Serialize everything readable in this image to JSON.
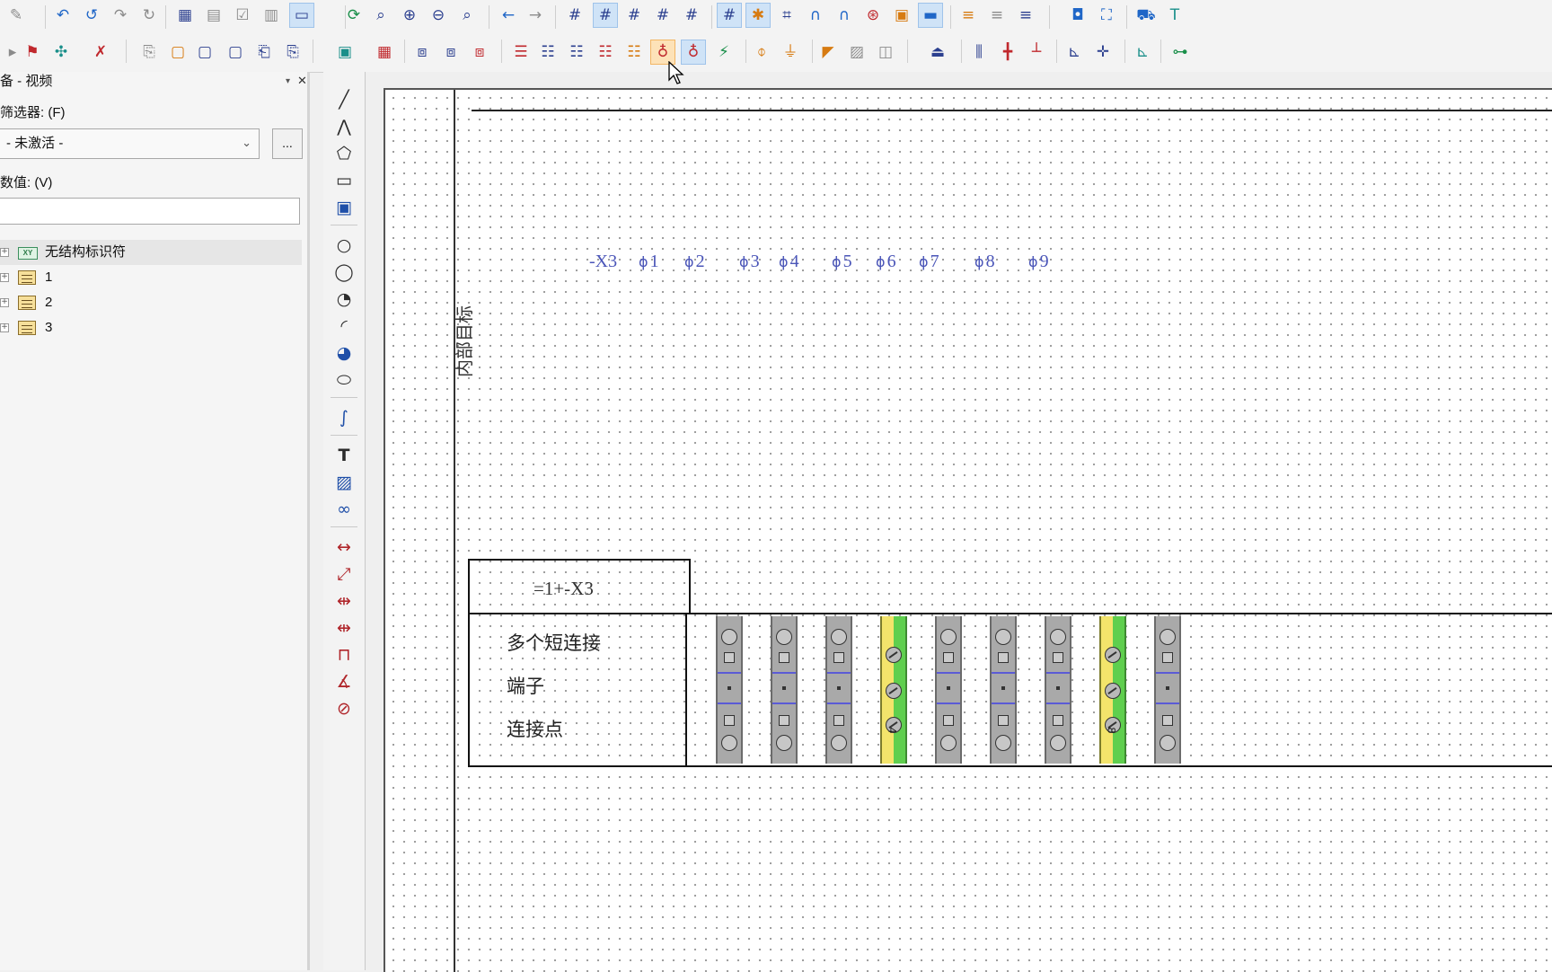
{
  "left_panel": {
    "title": "备 - 视频",
    "filter_label": "筛选器: (F)",
    "filter_value": "- 未激活 -",
    "more_button": "...",
    "value_label": "数值: (V)",
    "value_input": "",
    "tree": [
      {
        "label": "无结构标识符",
        "icon": "xy-structure-icon",
        "selected": true
      },
      {
        "label": "1",
        "icon": "list-icon",
        "selected": false
      },
      {
        "label": "2",
        "icon": "list-icon",
        "selected": false
      },
      {
        "label": "3",
        "icon": "list-icon",
        "selected": false
      }
    ]
  },
  "canvas": {
    "vertical_title": "内部目标",
    "strip_label": "-X3",
    "terminals": [
      "1",
      "2",
      "3",
      "4",
      "5",
      "6",
      "7",
      "8",
      "9"
    ],
    "strip_header": "=1+-X3",
    "rows": [
      "多个短连接",
      "端子",
      "连接点"
    ],
    "terminal_types": [
      "std",
      "std",
      "std",
      "pe",
      "std",
      "std",
      "std",
      "pe",
      "std"
    ],
    "pe_numbers": [
      "4",
      "8"
    ]
  },
  "colors": {
    "accent": "#1f66c7",
    "terminal_label": "#4a55b8",
    "pe_yellow": "#f3e46b",
    "pe_green": "#5fcf4e"
  }
}
